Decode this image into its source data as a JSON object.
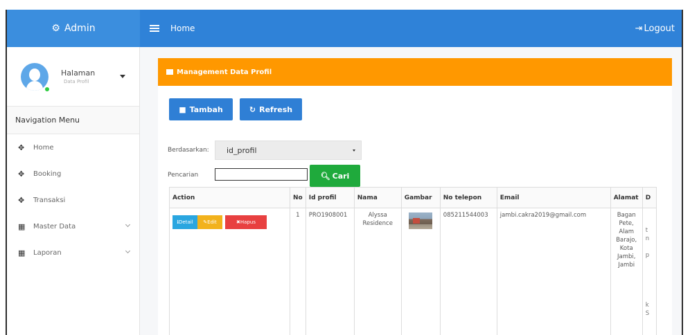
{
  "header": {
    "brand": "Admin",
    "brand_icon": "settings-icon",
    "title": "Home",
    "logout": "Logout",
    "brand_color": "#3b8ede",
    "nav_color": "#2f82d8"
  },
  "sidebar": {
    "user_name": "Halaman",
    "user_role": "Data Profil",
    "nav_header": "Navigation Menu",
    "items": [
      {
        "label": "Home",
        "icon": "move-icon"
      },
      {
        "label": "Booking",
        "icon": "move-icon"
      },
      {
        "label": "Transaksi",
        "icon": "move-icon"
      },
      {
        "label": "Master Data",
        "icon": "grid-icon"
      },
      {
        "label": "Laporan",
        "icon": "grid-icon"
      }
    ]
  },
  "panel": {
    "title": "Management Data Profil",
    "title_color": "#ff9800",
    "add_label": "Tambah",
    "refresh_label": "Refresh",
    "filter_label": "Berdasarkan:",
    "filter_value": "id_profil",
    "search_label": "Pencarian",
    "search_value": "",
    "search_button": "Cari"
  },
  "table": {
    "headers": [
      "Action",
      "No",
      "Id profil",
      "Nama",
      "Gambar",
      "No telepon",
      "Email",
      "Alamat",
      "D"
    ],
    "row": {
      "detail": "Detail",
      "edit": "Edit",
      "hapus": "Hapus",
      "no": "1",
      "id_profil": "PRO1908001",
      "nama": "Alyssa Residence",
      "telepon": "085211544003",
      "email": "jambi.cakra2019@gmail.com",
      "alamat": "Bagan Pete, Alam Barajo, Kota Jambi, Jambi",
      "d_partial": [
        "t",
        "n",
        "",
        "p",
        "",
        "",
        "",
        "k",
        "S"
      ]
    }
  }
}
